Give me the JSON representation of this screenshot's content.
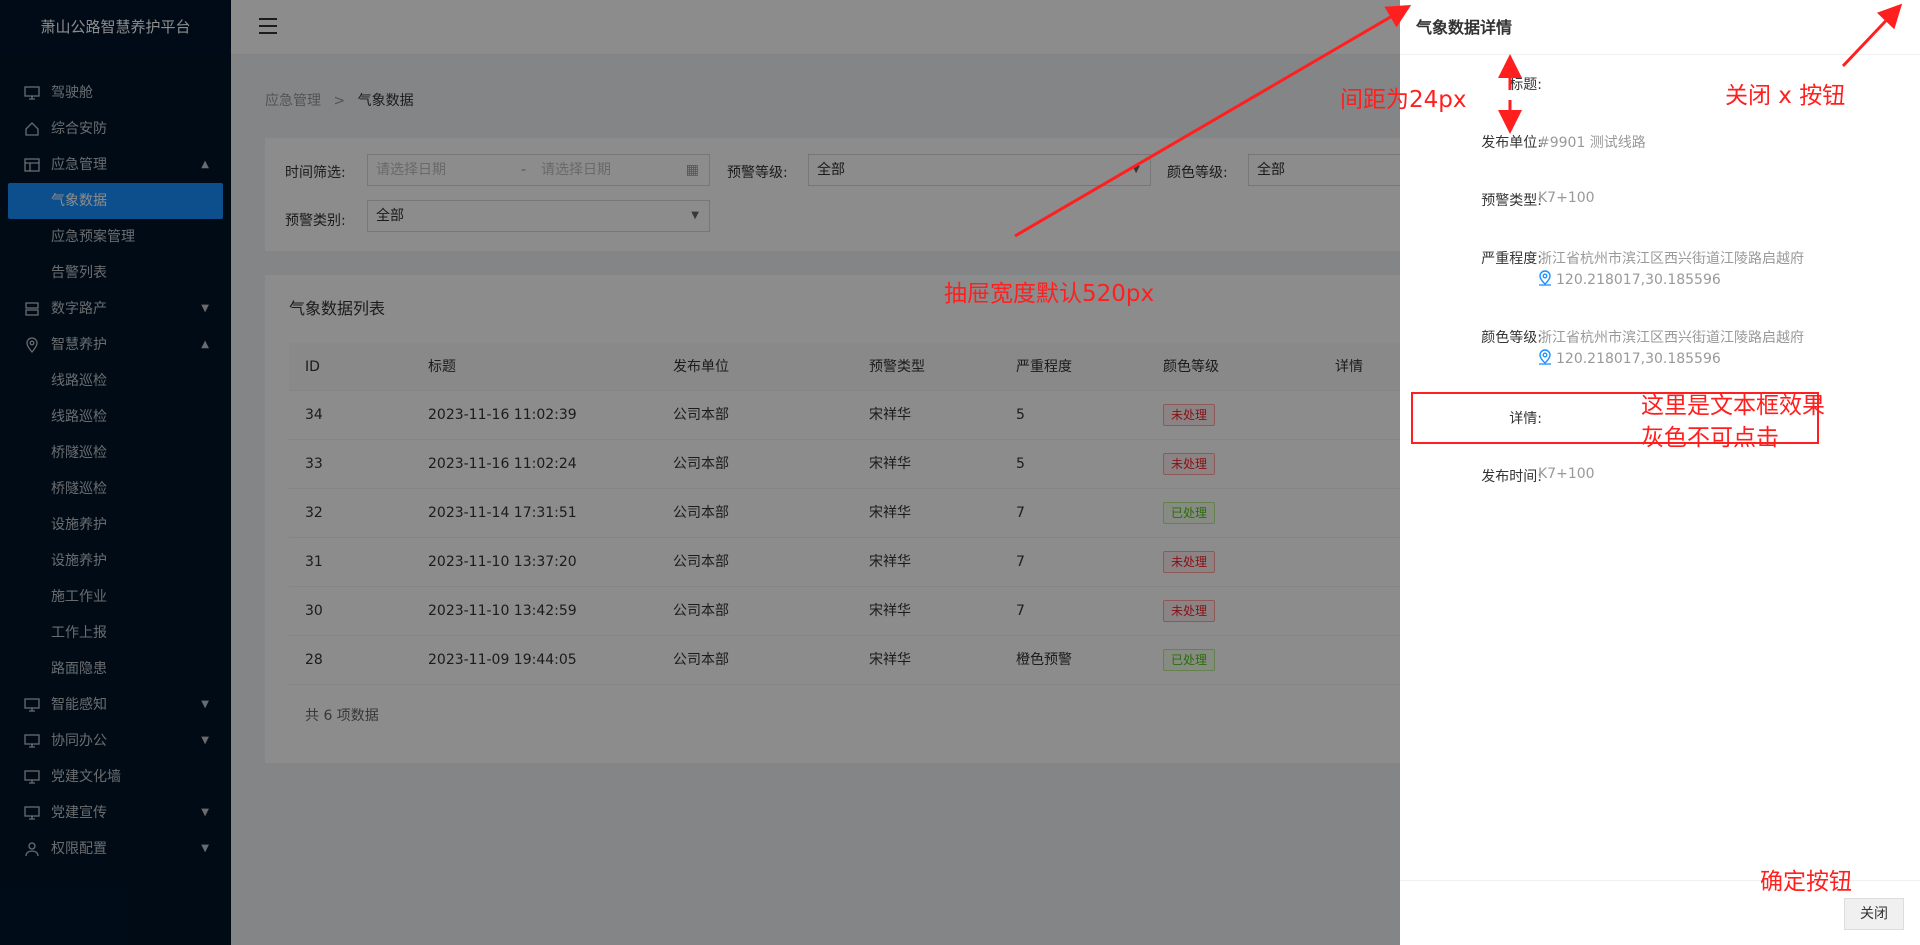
{
  "sidebar": {
    "title": "萧山公路智慧养护平台",
    "items": [
      {
        "label": "驾驶舱",
        "icon": "monitor-icon",
        "arrow": ""
      },
      {
        "label": "综合安防",
        "icon": "home-icon",
        "arrow": ""
      },
      {
        "label": "应急管理",
        "icon": "table-icon",
        "arrow": "▲"
      },
      {
        "label": "气象数据",
        "sub": true,
        "active": true
      },
      {
        "label": "应急预案管理",
        "sub": true
      },
      {
        "label": "告警列表",
        "sub": true
      },
      {
        "label": "数字路产",
        "icon": "database-icon",
        "arrow": "▼"
      },
      {
        "label": "智慧养护",
        "icon": "location-icon",
        "arrow": "▲"
      },
      {
        "label": "线路巡检",
        "sub": true
      },
      {
        "label": "线路巡检",
        "sub": true
      },
      {
        "label": "桥隧巡检",
        "sub": true
      },
      {
        "label": "桥隧巡检",
        "sub": true
      },
      {
        "label": "设施养护",
        "sub": true
      },
      {
        "label": "设施养护",
        "sub": true
      },
      {
        "label": "施工作业",
        "sub": true
      },
      {
        "label": "工作上报",
        "sub": true
      },
      {
        "label": "路面隐患",
        "sub": true
      },
      {
        "label": "智能感知",
        "icon": "monitor-icon",
        "arrow": "▼"
      },
      {
        "label": "协同办公",
        "icon": "monitor-icon",
        "arrow": "▼"
      },
      {
        "label": "党建文化墙",
        "icon": "monitor-icon",
        "arrow": ""
      },
      {
        "label": "党建宣传",
        "icon": "monitor-icon",
        "arrow": "▼"
      },
      {
        "label": "权限配置",
        "icon": "user-icon",
        "arrow": "▼"
      }
    ]
  },
  "breadcrumb": {
    "parent": "应急管理",
    "sep": ">",
    "current": "气象数据"
  },
  "filters": {
    "time_label": "时间筛选:",
    "start_placeholder": "请选择日期",
    "range_sep": "-",
    "end_placeholder": "请选择日期",
    "warn_level_label": "预警等级:",
    "warn_level_value": "全部",
    "color_level_label": "颜色等级:",
    "color_level_value": "全部",
    "warn_type_label": "预警类别:",
    "warn_type_value": "全部"
  },
  "table": {
    "title": "气象数据列表",
    "columns": [
      "ID",
      "标题",
      "发布单位",
      "预警类型",
      "严重程度",
      "颜色等级",
      "详情"
    ],
    "rows": [
      {
        "id": "34",
        "title": "2023-11-16 11:02:39",
        "unit": "公司本部",
        "type": "宋祥华",
        "severity": "5",
        "status": "未处理",
        "status_color": "red"
      },
      {
        "id": "33",
        "title": "2023-11-16 11:02:24",
        "unit": "公司本部",
        "type": "宋祥华",
        "severity": "5",
        "status": "未处理",
        "status_color": "red"
      },
      {
        "id": "32",
        "title": "2023-11-14 17:31:51",
        "unit": "公司本部",
        "type": "宋祥华",
        "severity": "7",
        "status": "已处理",
        "status_color": "green"
      },
      {
        "id": "31",
        "title": "2023-11-10 13:37:20",
        "unit": "公司本部",
        "type": "宋祥华",
        "severity": "7",
        "status": "未处理",
        "status_color": "red"
      },
      {
        "id": "30",
        "title": "2023-11-10 13:42:59",
        "unit": "公司本部",
        "type": "宋祥华",
        "severity": "7",
        "status": "未处理",
        "status_color": "red"
      },
      {
        "id": "28",
        "title": "2023-11-09 19:44:05",
        "unit": "公司本部",
        "type": "宋祥华",
        "severity": "橙色预警",
        "status": "已处理",
        "status_color": "green"
      }
    ],
    "total": "共 6 项数据"
  },
  "drawer": {
    "title": "气象数据详情",
    "fields": {
      "title_label": "标题:",
      "unit_label": "发布单位:",
      "unit_value": "#9901 测试线路",
      "type_label": "预警类型:",
      "type_value": "K7+100",
      "severity_label": "严重程度:",
      "severity_value": "浙江省杭州市滨江区西兴街道江陵路启越府",
      "severity_coord": "120.218017,30.185596",
      "color_label": "颜色等级:",
      "color_value": "浙江省杭州市滨江区西兴街道江陵路启越府",
      "color_coord": "120.218017,30.185596",
      "detail_label": "详情:",
      "time_label": "发布时间:",
      "time_value": "K7+100"
    },
    "close_button": "关闭"
  },
  "annotations": {
    "spacing": "间距为24px",
    "close_x": "关闭 x 按钮",
    "drawer_width": "抽屉宽度默认520px",
    "textbox_line1": "这里是文本框效果",
    "textbox_line2": "灰色不可点击",
    "confirm": "确定按钮"
  },
  "colors": {
    "primary": "#1890ff",
    "sidebar": "#001529",
    "annotation": "#ff1f1f"
  }
}
